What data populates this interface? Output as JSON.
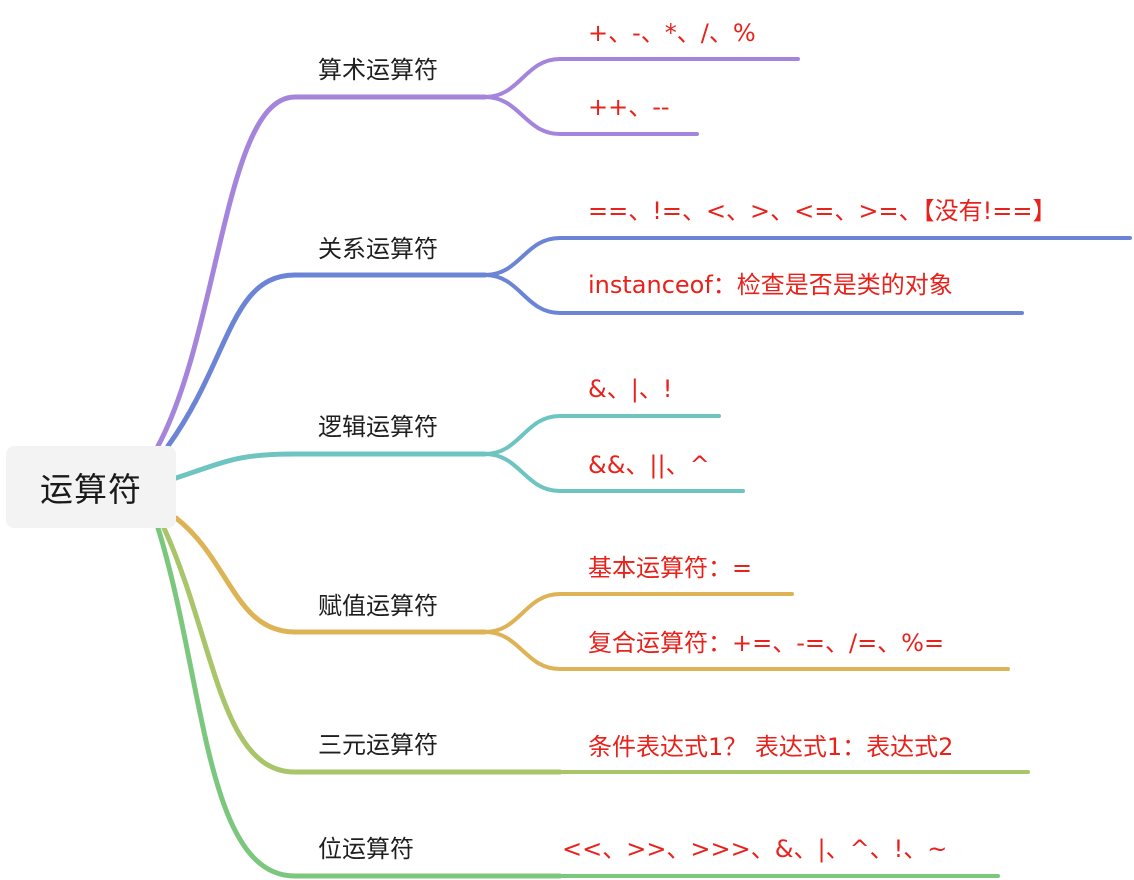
{
  "root": {
    "label": "运算符"
  },
  "branches": [
    {
      "label": "算术运算符",
      "color": "#a585dc",
      "leaves": [
        "+、-、*、/、%",
        "++、--"
      ]
    },
    {
      "label": "关系运算符",
      "color": "#6c84d6",
      "leaves": [
        "==、!=、<、>、<=、>=、【没有!==】",
        "instanceof：检查是否是类的对象"
      ]
    },
    {
      "label": "逻辑运算符",
      "color": "#6ec4c0",
      "leaves": [
        "&、|、!",
        "&&、||、^"
      ]
    },
    {
      "label": "赋值运算符",
      "color": "#ddb355",
      "leaves": [
        "基本运算符：=",
        "复合运算符：+=、-=、/=、%="
      ]
    },
    {
      "label": "三元运算符",
      "color": "#a9c56a",
      "leaves": [
        "条件表达式1？ 表达式1：表达式2"
      ]
    },
    {
      "label": "位运算符",
      "color": "#7cc77e",
      "leaves": [
        "<<、>>、>>>、&、|、^、!、~"
      ]
    }
  ]
}
